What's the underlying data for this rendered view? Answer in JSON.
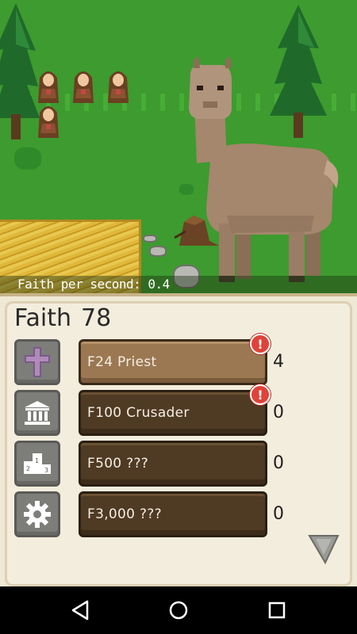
{
  "scene": {
    "faith_per_second_label": "Faith per second: 0.4",
    "colors": {
      "grass": "#3d9b2f",
      "wheat": "#e0b83a",
      "llama": "#a4876d"
    }
  },
  "panel": {
    "faith_label": "Faith",
    "faith_value": "78",
    "items": [
      {
        "icon": "cross-icon",
        "label": "F24 Priest",
        "count": "4",
        "alert": "!",
        "affordable": true
      },
      {
        "icon": "temple-icon",
        "label": "F100 Crusader",
        "count": "0",
        "alert": "!",
        "affordable": false
      },
      {
        "icon": "podium-icon",
        "label": "F500 ???",
        "count": "0",
        "alert": "",
        "affordable": false
      },
      {
        "icon": "gear-icon",
        "label": "F3,000 ???",
        "count": "0",
        "alert": "",
        "affordable": false
      }
    ],
    "scroll_icon": "chevron-down-icon"
  },
  "navbar": {
    "icons": [
      "back-triangle-icon",
      "home-circle-icon",
      "recents-square-icon"
    ]
  }
}
